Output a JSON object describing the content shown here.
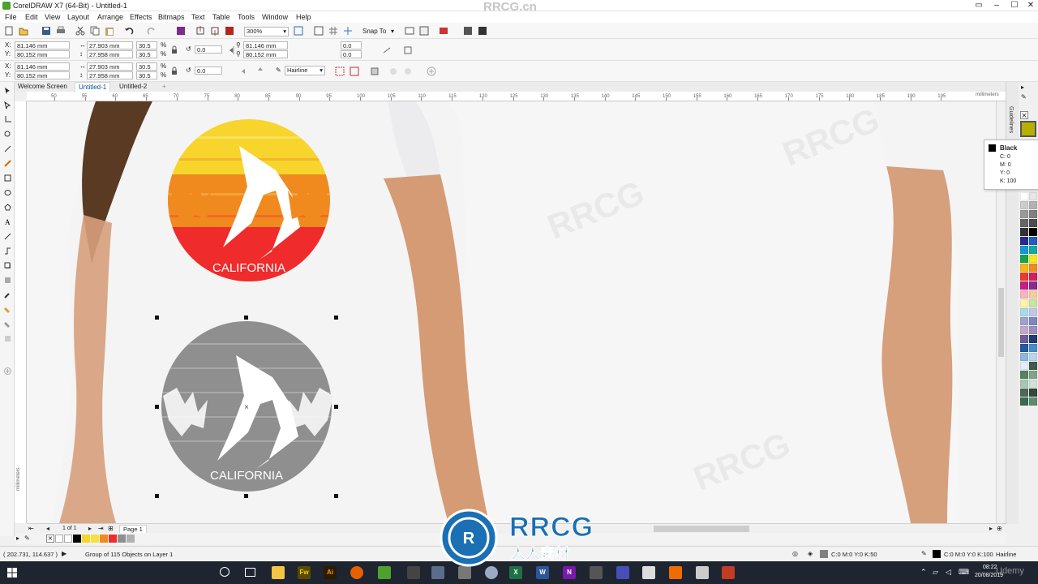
{
  "window": {
    "title": "CorelDRAW X7 (64-Bit) - Untitled-1"
  },
  "watermark": {
    "top_right": "RRCG.cn",
    "logo_main": "RRCG",
    "logo_sub": "人人素材",
    "repeated": "RRCG"
  },
  "menu": [
    "File",
    "Edit",
    "View",
    "Layout",
    "Arrange",
    "Effects",
    "Bitmaps",
    "Text",
    "Table",
    "Tools",
    "Window",
    "Help"
  ],
  "standard_toolbar": {
    "zoom": "300%",
    "snap_to": "Snap To"
  },
  "property_bar_1": {
    "x": "81.146 mm",
    "y": "80.152 mm",
    "w": "27.903 mm",
    "h": "27.958 mm",
    "scale_w": "30.5",
    "scale_h": "30.5",
    "pct": "%",
    "rotation": "0.0",
    "pos2_x": "81.146 mm",
    "pos2_y": "80.152 mm",
    "skew_h": "0.0",
    "skew_v": "0.0"
  },
  "property_bar_2": {
    "x": "81.146 mm",
    "y": "80.152 mm",
    "w": "27.903 mm",
    "h": "27.958 mm",
    "scale_w": "30.5",
    "scale_h": "30.5",
    "pct": "%",
    "rotation": "0.0",
    "outline": "Hairline"
  },
  "doc_tabs": [
    "Welcome Screen",
    "Untitled-1",
    "Untitled-2"
  ],
  "ruler": {
    "units": "millimeters",
    "ticks": [
      "50",
      "55",
      "60",
      "65",
      "70",
      "75",
      "80",
      "85",
      "90",
      "95",
      "100",
      "105",
      "110",
      "115",
      "120",
      "125",
      "130",
      "135",
      "140",
      "145",
      "150",
      "155",
      "160",
      "165",
      "170",
      "175",
      "180",
      "185",
      "190",
      "195"
    ],
    "vertical_units": "millimeters"
  },
  "artwork": {
    "color_label": "CALIFORNIA",
    "gray_label": "CALIFORNIA"
  },
  "color_tooltip": {
    "name": "Black",
    "c": "C: 0",
    "m": "M: 0",
    "y": "Y: 0",
    "k": "K: 100"
  },
  "docker_tab": "Guidelines",
  "page_nav": {
    "counter": "1 of 1",
    "page_tab": "Page 1"
  },
  "status": {
    "coords": "( 202.731, 114.637 )",
    "selection": "Group of 115 Objects on Layer 1",
    "fill": "C:0 M:0 Y:0 K:50",
    "outline": "C:0 M:0 Y:0 K:100",
    "outline_width": "Hairline"
  },
  "taskbar": {
    "time": "08:22",
    "date": "20/08/2019",
    "overlay": "Udemy",
    "apps": [
      "Fw",
      "Ai",
      "W",
      "N",
      "X"
    ]
  },
  "colors": {
    "accent_blue": "#0078d7",
    "sun_yellow": "#f7d52d",
    "sun_orange": "#f08a1f",
    "sun_red": "#ef2b2b",
    "gray_art": "#8f8f8f",
    "skin": "#d7a07c"
  },
  "palette_swatches": [
    "#ffffff",
    "#e6e6e6",
    "#cccccc",
    "#b3b3b3",
    "#999999",
    "#808080",
    "#666666",
    "#4d4d4d",
    "#333333",
    "#000000",
    "#2a2a8e",
    "#1f5fbf",
    "#1597d5",
    "#13a9a0",
    "#18a24a",
    "#f5ea14",
    "#f7b51d",
    "#f08a1f",
    "#ee3b24",
    "#d51c5c",
    "#c51f84",
    "#8a2a8f",
    "#f8b3c3",
    "#f3ce9b",
    "#fff3a6",
    "#c7e3a5",
    "#a7dbe8",
    "#c3c7e6",
    "#9da3d0",
    "#7e86c0",
    "#c4a9c4",
    "#9f8dbf",
    "#6e5b99",
    "#1d3c6e",
    "#25589c",
    "#4a8ac7",
    "#8cb6e0",
    "#b9d5ed",
    "#e3eef8",
    "#3d5c4a",
    "#5a7f63",
    "#7fa48a",
    "#a9c7b0",
    "#d1e3d6",
    "#4f6658",
    "#2f4b3b",
    "#3a6b50",
    "#5e8c6d"
  ]
}
